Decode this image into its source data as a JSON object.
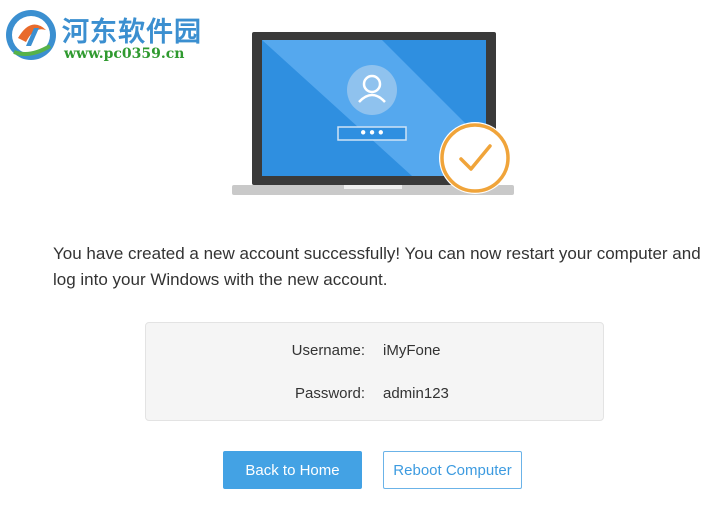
{
  "watermark": {
    "title": "河东软件园",
    "url": "www.pc0359.cn"
  },
  "illustration": {
    "password_mask": "•••",
    "icons": [
      "laptop-icon",
      "user-icon",
      "checkmark-icon"
    ]
  },
  "message": "You have created a new account successfully! You can now restart your computer and log into your Windows with the new account.",
  "credentials": {
    "username_label": "Username:",
    "username_value": "iMyFone",
    "password_label": "Password:",
    "password_value": "admin123"
  },
  "buttons": {
    "back_home": "Back to Home",
    "reboot": "Reboot Computer"
  },
  "colors": {
    "primary": "#43a2e4",
    "screen": "#2f8fe0",
    "success_ring": "#f0a43a",
    "card_bg": "#f5f5f5"
  }
}
